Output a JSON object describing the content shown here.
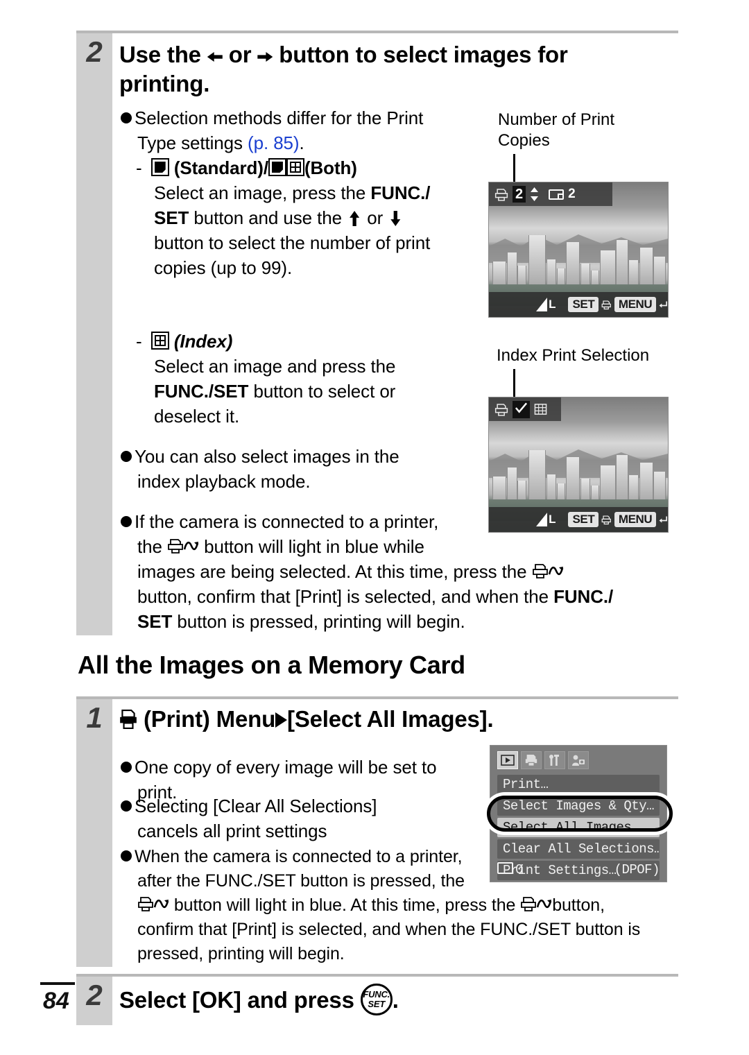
{
  "page": {
    "number": "84"
  },
  "step2_top": {
    "number": "2",
    "heading_a": "Use the",
    "heading_b": "or",
    "heading_c": "button to select images for",
    "heading_d": "printing.",
    "bullet1_l1": "Selection methods differ for the Print",
    "bullet1_l2": "Type settings",
    "bullet1_link": "(p. 85)",
    "bullet1_end": ".",
    "sub1_label_a": "(Standard)/",
    "sub1_label_b": "(Both)",
    "sub1_l1_a": "Select an image, press the",
    "sub1_l1_b": "FUNC./",
    "sub1_l2_a": "SET",
    "sub1_l2_b": "button and use the",
    "sub1_l2_c": "or",
    "sub1_l3": "button to select the number of print",
    "sub1_l4": "copies (up to 99).",
    "sub2_label": "(Index)",
    "sub2_l1": "Select an image and press the",
    "sub2_l2_a": "FUNC./SET",
    "sub2_l2_b": "button to select or",
    "sub2_l3": "deselect it.",
    "bullet2_l1": "You can also select images in the",
    "bullet2_l2": "index playback mode.",
    "bullet3_l1": "If the camera is connected to a printer,",
    "bullet3_l2_a": "the",
    "bullet3_l2_b": "button will light in blue while",
    "bullet3_l3_a": "images are being selected. At this time, press the",
    "bullet3_l4_a": "button, confirm that [Print] is selected, and when the",
    "bullet3_l4_b": "FUNC./",
    "bullet3_l5_a": "SET",
    "bullet3_l5_b": "button is pressed, printing will begin."
  },
  "callouts": {
    "copies_l1": "Number of Print",
    "copies_l2": "Copies",
    "index_label": "Index Print Selection"
  },
  "lcd_copies": {
    "print_icon": "print-icon",
    "count_value": "2",
    "updown_icon": "up-down-arrows-icon",
    "frame_count": "2",
    "quality_label": "L",
    "btn_set": "SET",
    "btn_print_icon": "print-icon",
    "btn_menu": "MENU",
    "btn_back_icon": "return-arrow-icon"
  },
  "lcd_index": {
    "print_icon": "print-icon",
    "check_icon": "checkmark-icon",
    "index_icon": "index-grid-icon",
    "quality_label": "L",
    "btn_set": "SET",
    "btn_print_icon": "print-icon",
    "btn_menu": "MENU",
    "btn_back_icon": "return-arrow-icon"
  },
  "section": {
    "title": "All the Images on a Memory Card"
  },
  "step1": {
    "number": "1",
    "heading_a": "(Print) Menu",
    "heading_b": "[Select All Images].",
    "bullet1_l1": "One copy of every image will be set to",
    "bullet1_l2": "print.",
    "bullet2_l1": "Selecting [Clear All Selections]",
    "bullet2_l2": "cancels all print settings",
    "bullet3_l1": "When the camera is connected to a printer,",
    "bullet3_l2": "after the FUNC./SET button is pressed, the",
    "bullet3_l3": "button will light in blue. At this time, press the",
    "bullet3_l3b": "button,",
    "bullet3_l4": "confirm that [Print] is selected, and when the FUNC./SET button is",
    "bullet3_l5": "pressed, printing will begin."
  },
  "print_menu": {
    "tabs": [
      {
        "name": "playback-tab",
        "icon": "play-icon",
        "active": true
      },
      {
        "name": "print-tab",
        "icon": "printer-icon",
        "active": false
      },
      {
        "name": "setup-tab",
        "icon": "wrench-icon",
        "active": false
      },
      {
        "name": "my-camera-tab",
        "icon": "my-camera-icon",
        "active": false
      }
    ],
    "items": [
      {
        "label": "Print…",
        "selected": false
      },
      {
        "label": "Select Images & Qty…",
        "selected": false
      },
      {
        "label": "Select All Images…",
        "selected": true
      },
      {
        "label": "Clear All Selections…",
        "selected": false
      },
      {
        "label": "Print Settings…",
        "selected": false
      }
    ],
    "footer_count": "0",
    "footer_badge": "(DPOF)"
  },
  "step2_bottom": {
    "number": "2",
    "heading_a": "Select [OK] and press",
    "heading_b": ".",
    "funcset_l1": "FUNC.",
    "funcset_l2": "SET"
  }
}
